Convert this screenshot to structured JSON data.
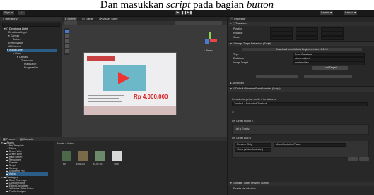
{
  "caption": {
    "prefix": "Dan masukkan",
    "italic1": "script",
    "middle": "pada bagian",
    "italic2": "button"
  },
  "toolbar": {
    "account_label": "Sign in",
    "layers_label": "Layers",
    "layout_label": "Layout"
  },
  "hierarchy": {
    "tab": "Hierarchy",
    "items": [
      "Directional Light",
      "Canvas",
      "Button",
      "EventSystem",
      "ARCamera",
      "ImageTarget",
      "Video",
      "Canvas",
      "Transform",
      "PlayButton",
      "ProgressBar"
    ]
  },
  "scene": {
    "tabs": [
      "Scene",
      "Game",
      "Asset Store"
    ],
    "persp": "< Persp",
    "poster": {
      "price": "Rp 4.000.000",
      "line": "Lorem"
    }
  },
  "project": {
    "tabs": [
      "Project",
      "Console"
    ],
    "breadcrumb": "Assets > Video",
    "tree": [
      "Assets",
      "Bar Template",
      "Editor",
      "Green Wire",
      "Green Wire",
      "Hard Green",
      "Resources",
      "Scenes",
      "Script",
      "Steamy",
      "TextMesh Pro",
      "Video",
      "Packages",
      "Code Coverage",
      "Custom NUnit",
      "Editor Coroutines",
      "JetBrains Rider Editor",
      "Profile Analyzer"
    ],
    "assets": [
      "bg",
      "fit_ARTG",
      "fit_JSTRG",
      "Video"
    ]
  },
  "inspector": {
    "tab": "Inspector",
    "transform_label": "Transform",
    "position_label": "Position",
    "rotation_label": "Rotation",
    "scale_label": "Scale",
    "image_target_label": "Image Target Behaviour (Script)",
    "download_label": "Download new Vuforia Engine version 10.19.0",
    "type_label": "Type",
    "type_value": "From Database",
    "database_label": "Database",
    "database_value": "videomarkeri",
    "image_target_field": "Image Target",
    "image_target_value": "markervideo",
    "add_target_label": "Add Target",
    "advanced_label": "Advanced",
    "observer_label": "Default Observer Event Handler (Script)",
    "consider_label": "Consider target as visible if its status is:",
    "tracked_value": "Tracked + Extended Tracked",
    "found_label": "On Target Found ()",
    "list_empty_label": "List is Empty",
    "lost_label": "On Target Lost ()",
    "runtime_value": "Runtime Only",
    "function_value": "VideoController.Pause",
    "object_value": "Video (VideoController)",
    "preview_label": "Image Target Preview (Script)",
    "enable_label": "Enable visualization"
  }
}
